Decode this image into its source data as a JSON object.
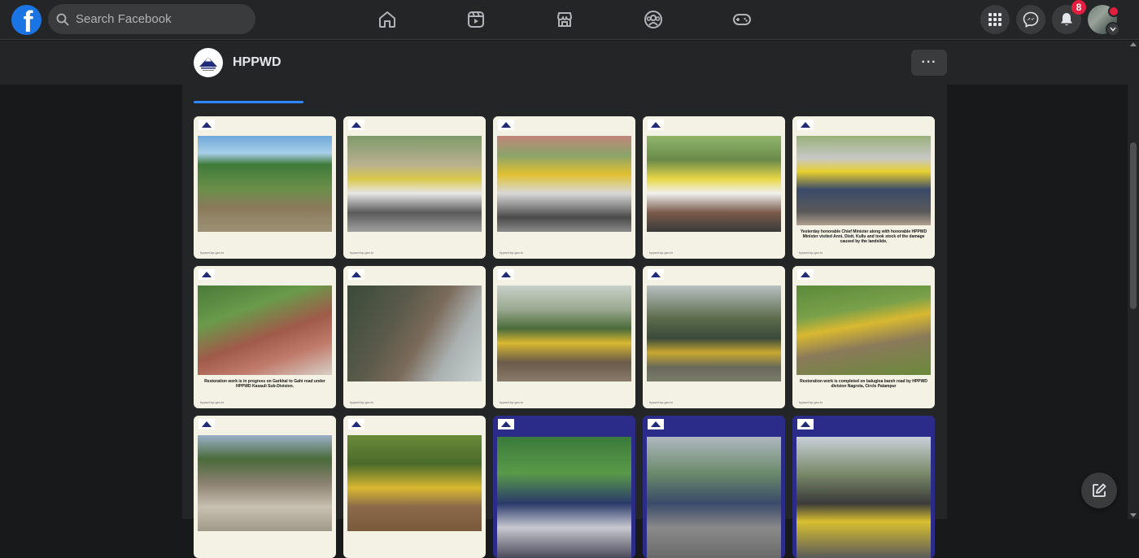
{
  "topbar": {
    "logo_letter": "f",
    "search_placeholder": "Search Facebook",
    "nav_icons": [
      "home-icon",
      "watch-icon",
      "marketplace-icon",
      "groups-icon",
      "gaming-icon"
    ],
    "notifications_badge": "8"
  },
  "page": {
    "name": "HPPWD",
    "more_label": "···"
  },
  "photos": [
    {
      "caption": "",
      "foot": "hppwd.hp.gov.in"
    },
    {
      "caption": "",
      "foot": "hppwd.hp.gov.in"
    },
    {
      "caption": "",
      "foot": "hppwd.hp.gov.in"
    },
    {
      "caption": "",
      "foot": "hppwd.hp.gov.in"
    },
    {
      "caption": "Yesterday honorable Chief Minister along with honorable HPPWD Minister visited Anni, Distt. Kullu and took stock of the damage caused by the landslide.",
      "foot": "hppwd.hp.gov.in"
    },
    {
      "caption": "Restoration work is in progress on Garkhal to Gahi road under HPPWD Kasauli Sub-Division.",
      "foot": "hppwd.hp.gov.in"
    },
    {
      "caption": "",
      "foot": "hppwd.hp.gov.in"
    },
    {
      "caption": "",
      "foot": "hppwd.hp.gov.in"
    },
    {
      "caption": "",
      "foot": "hppwd.hp.gov.in"
    },
    {
      "caption": "Restoration work is completed on balugloa barsh road by HPPWD division Nagrota, Circle Palampur",
      "foot": "hppwd.hp.gov.in"
    },
    {
      "caption": "",
      "foot": ""
    },
    {
      "caption": "",
      "foot": ""
    },
    {
      "caption": "",
      "foot": ""
    },
    {
      "caption": "",
      "foot": ""
    },
    {
      "caption": "",
      "foot": ""
    }
  ],
  "colors": {
    "accent": "#2d88ff",
    "badge": "#e41e3f",
    "brand": "#1b74e4"
  }
}
